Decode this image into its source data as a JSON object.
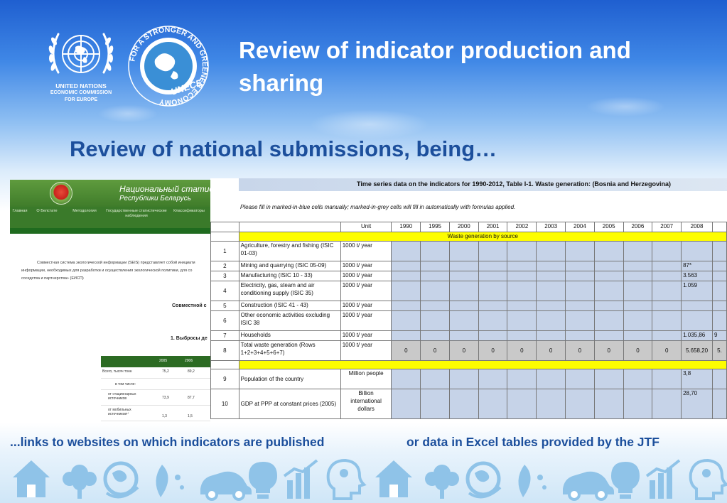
{
  "slide": {
    "title": "Review of indicator production and sharing",
    "subtitle": "Review of national submissions, being…",
    "caption_left": "...links to websites on which indicators are published",
    "caption_right": "or data in Excel tables provided by the JTF"
  },
  "un_logo": {
    "line1": "UNITED NATIONS",
    "line2": "ECONOMIC COMMISSION",
    "line3": "FOR EUROPE"
  },
  "unece_logo": {
    "ring_text": "FOR A STRONGER AND GREENER ECONOMY",
    "brand": "UNECE"
  },
  "belarus_site": {
    "title_line1": "Национальный статистич",
    "title_line2": "Республики Беларусь",
    "nav": [
      "Главная",
      "О Белстате",
      "Методология",
      "Государственные статистические наблюдения",
      "Классификаторы"
    ],
    "para_line1": "Совместная система экологической информации (SEIS) представляет собой инициати",
    "para_line2": "информации, необходимых для разработки и осуществления экологической политики, для со",
    "para_line3": "соседства и партнерства» (ЕИСП)",
    "heading1": "Совместной с",
    "heading2": "1. Выбросы де",
    "table_years": [
      "2005",
      "2006"
    ],
    "table_rows": [
      {
        "label": "Всего, тысяч тонн",
        "v1": "75,2",
        "v2": "89,2"
      },
      {
        "label": "в том числе:",
        "v1": "",
        "v2": ""
      },
      {
        "label": "от стационарных источников",
        "v1": "73,9",
        "v2": "87,7"
      },
      {
        "label": "от мобильных источников¹⁾",
        "v1": "1,3",
        "v2": "1,5"
      }
    ]
  },
  "excel": {
    "title": "Time series data on the indicators for 1990-2012, Table I-1. Waste generation: (Bosnia and Herzegovina)",
    "instruction": "Please fill in marked-in-blue cells manually; marked-in-grey cells will fill in automatically with formulas applied.",
    "header_unit": "Unit",
    "years": [
      "1990",
      "1995",
      "2000",
      "2001",
      "2002",
      "2003",
      "2004",
      "2005",
      "2006",
      "2007",
      "2008"
    ],
    "section_label": "Waste generation by source",
    "rows": [
      {
        "no": "1",
        "label": "Agriculture, forestry and fishing (ISIC 01-03)",
        "unit": "1000 t/ year",
        "v2008": ""
      },
      {
        "no": "2",
        "label": "Mining and quarrying (ISIC 05-09)",
        "unit": "1000 t/ year",
        "v2008": "87*"
      },
      {
        "no": "3",
        "label": "Manufacturing (ISIC 10 - 33)",
        "unit": "1000 t/ year",
        "v2008": "3.563"
      },
      {
        "no": "4",
        "label": "Electricity, gas, steam and air conditioning supply (ISIC 35)",
        "unit": "1000 t/ year",
        "v2008": "1.059"
      },
      {
        "no": "5",
        "label": "Construction (ISIC 41 - 43)",
        "unit": "1000 t/ year",
        "v2008": ""
      },
      {
        "no": "6",
        "label": "Other economic activities excluding ISIC 38",
        "unit": "1000 t/ year",
        "v2008": ""
      },
      {
        "no": "7",
        "label": "Households",
        "unit": "1000 t/ year",
        "v2008": "1.035,86"
      },
      {
        "no": "8",
        "label": "Total waste generation (Rows 1+2+3+4+5+6+7)",
        "unit": "1000 t/ year",
        "v2008": "5.658,20",
        "zeros": "0"
      }
    ],
    "rows2": [
      {
        "no": "9",
        "label": "Population of the country",
        "unit": "Million people",
        "v2008": "3,8"
      },
      {
        "no": "10",
        "label": "GDP at PPP at constant prices (2005)",
        "unit": "Billion international dollars",
        "v2008": "28,70"
      }
    ],
    "clipped_right_values": [
      "9",
      "5."
    ]
  },
  "icons": [
    "house-icon",
    "tree-icon",
    "globe-icon",
    "leaf-icon",
    "car-icon",
    "lightbulb-icon",
    "chart-icon",
    "head-gear-icon"
  ],
  "colors": {
    "title_blue": "#1c4f9c",
    "excel_blue_cell": "#c6d3e8",
    "excel_grey_cell": "#c9c9c9",
    "excel_yellow": "#fdfd00",
    "belarus_green": "#3f7c2a"
  }
}
